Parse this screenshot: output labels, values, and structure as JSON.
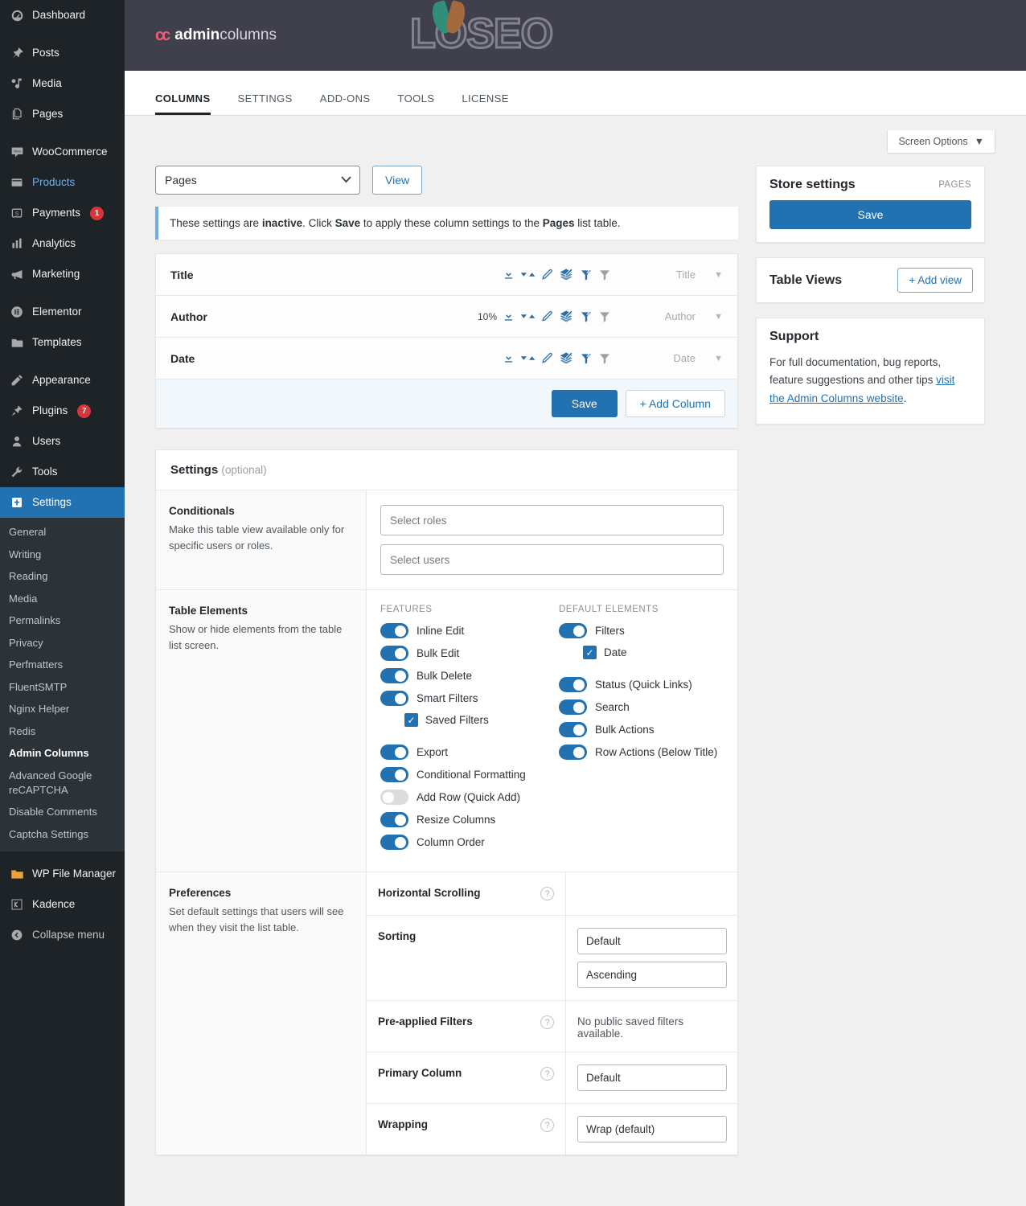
{
  "sidebar": {
    "items": [
      {
        "label": "Dashboard",
        "icon": "dashboard-icon",
        "name": "dashboard"
      },
      {
        "sep": true
      },
      {
        "label": "Posts",
        "icon": "pin-icon",
        "name": "posts"
      },
      {
        "label": "Media",
        "icon": "media-icon",
        "name": "media"
      },
      {
        "label": "Pages",
        "icon": "pages-icon",
        "name": "pages"
      },
      {
        "sep": true
      },
      {
        "label": "WooCommerce",
        "icon": "woocommerce-icon",
        "name": "woocommerce"
      },
      {
        "label": "Products",
        "icon": "products-icon",
        "name": "products",
        "blue": true
      },
      {
        "label": "Payments",
        "icon": "payments-icon",
        "name": "payments",
        "badge": "1"
      },
      {
        "label": "Analytics",
        "icon": "analytics-icon",
        "name": "analytics"
      },
      {
        "label": "Marketing",
        "icon": "marketing-icon",
        "name": "marketing"
      },
      {
        "sep": true
      },
      {
        "label": "Elementor",
        "icon": "elementor-icon",
        "name": "elementor"
      },
      {
        "label": "Templates",
        "icon": "templates-icon",
        "name": "templates"
      },
      {
        "sep": true
      },
      {
        "label": "Appearance",
        "icon": "appearance-icon",
        "name": "appearance"
      },
      {
        "label": "Plugins",
        "icon": "plugins-icon",
        "name": "plugins",
        "badge": "7"
      },
      {
        "label": "Users",
        "icon": "users-icon",
        "name": "users"
      },
      {
        "label": "Tools",
        "icon": "tools-icon",
        "name": "tools"
      },
      {
        "label": "Settings",
        "icon": "settings-icon",
        "name": "settings",
        "active": true
      }
    ],
    "submenu": [
      {
        "label": "General"
      },
      {
        "label": "Writing"
      },
      {
        "label": "Reading"
      },
      {
        "label": "Media"
      },
      {
        "label": "Permalinks"
      },
      {
        "label": "Privacy"
      },
      {
        "label": "Perfmatters"
      },
      {
        "label": "FluentSMTP"
      },
      {
        "label": "Nginx Helper"
      },
      {
        "label": "Redis"
      },
      {
        "label": "Admin Columns",
        "current": true
      },
      {
        "label": "Advanced Google reCAPTCHA"
      },
      {
        "label": "Disable Comments"
      },
      {
        "label": "Captcha Settings"
      }
    ],
    "bottom": [
      {
        "label": "WP File Manager",
        "icon": "folder-icon",
        "name": "wp-file-manager"
      },
      {
        "label": "Kadence",
        "icon": "kadence-icon",
        "name": "kadence"
      },
      {
        "label": "Collapse menu",
        "icon": "collapse-icon",
        "name": "collapse-menu"
      }
    ]
  },
  "header": {
    "logo_mark": "cc",
    "logo_bold": "admin",
    "logo_rest": "columns",
    "watermark_pre": "LO",
    "watermark_post": "SEO",
    "tabs": [
      {
        "label": "COLUMNS",
        "active": true
      },
      {
        "label": "SETTINGS",
        "active": false
      },
      {
        "label": "ADD-ONS",
        "active": false
      },
      {
        "label": "TOOLS",
        "active": false
      },
      {
        "label": "LICENSE",
        "active": false
      }
    ]
  },
  "screen_options": {
    "label": "Screen Options",
    "caret": "▼"
  },
  "toolbar": {
    "list_table_value": "Pages",
    "list_table_options": [
      "Pages"
    ],
    "view_label": "View"
  },
  "notice": {
    "part1": "These settings are ",
    "bold1": "inactive",
    "part2": ". Click ",
    "bold2": "Save",
    "part3": " to apply these column settings to the ",
    "bold3": "Pages",
    "part4": " list table."
  },
  "columns": {
    "rows": [
      {
        "name": "Title",
        "width": "",
        "type": "Title"
      },
      {
        "name": "Author",
        "width": "10%",
        "type": "Author"
      },
      {
        "name": "Date",
        "width": "",
        "type": "Date"
      }
    ],
    "icons": [
      "export-icon",
      "sort-icon",
      "edit-icon",
      "bulk-edit-icon",
      "smart-filter-icon",
      "filter-icon"
    ],
    "save_label": "Save",
    "add_column_label": "+ Add Column"
  },
  "settings": {
    "title": "Settings",
    "optional": "(optional)",
    "conditionals": {
      "title": "Conditionals",
      "description": "Make this table view available only for specific users or roles.",
      "roles_placeholder": "Select roles",
      "users_placeholder": "Select users"
    },
    "table_elements": {
      "title": "Table Elements",
      "description": "Show or hide elements from the table list screen.",
      "features_title": "FEATURES",
      "default_title": "DEFAULT ELEMENTS",
      "features": [
        {
          "label": "Inline Edit",
          "on": true
        },
        {
          "label": "Bulk Edit",
          "on": true
        },
        {
          "label": "Bulk Delete",
          "on": true
        },
        {
          "label": "Smart Filters",
          "on": true
        }
      ],
      "features_checkbox": {
        "label": "Saved Filters",
        "checked": true
      },
      "features2": [
        {
          "label": "Export",
          "on": true
        },
        {
          "label": "Conditional Formatting",
          "on": true
        },
        {
          "label": "Add Row (Quick Add)",
          "on": false
        },
        {
          "label": "Resize Columns",
          "on": true
        },
        {
          "label": "Column Order",
          "on": true
        }
      ],
      "default_first": {
        "label": "Filters",
        "on": true
      },
      "default_checkbox": {
        "label": "Date",
        "checked": true
      },
      "defaults2": [
        {
          "label": "Status (Quick Links)",
          "on": true
        },
        {
          "label": "Search",
          "on": true
        },
        {
          "label": "Bulk Actions",
          "on": true
        },
        {
          "label": "Row Actions (Below Title)",
          "on": true
        }
      ]
    },
    "preferences": {
      "title": "Preferences",
      "description": "Set default settings that users will see when they visit the list table.",
      "rows": [
        {
          "label": "Horizontal Scrolling",
          "help": true,
          "kind": "toggle",
          "on": false
        },
        {
          "label": "Sorting",
          "help": false,
          "kind": "selects",
          "values": [
            "Default",
            "Ascending"
          ]
        },
        {
          "label": "Pre-applied Filters",
          "help": true,
          "kind": "note",
          "note": "No public saved filters available."
        },
        {
          "label": "Primary Column",
          "help": true,
          "kind": "select",
          "value": "Default"
        },
        {
          "label": "Wrapping",
          "help": true,
          "kind": "select",
          "value": "Wrap (default)"
        }
      ]
    }
  },
  "store_settings": {
    "title": "Store settings",
    "tag": "PAGES",
    "save_label": "Save"
  },
  "table_views": {
    "title": "Table Views",
    "add_label": "+ Add view"
  },
  "support": {
    "title": "Support",
    "text_before": "For full documentation, bug reports, feature suggestions and other tips ",
    "link": "visit the Admin Columns website",
    "text_after": "."
  },
  "colors": {
    "accent": "#2271b1",
    "header_bg": "#403f4c",
    "sidebar_bg": "#1d2327",
    "badge": "#d63638"
  }
}
